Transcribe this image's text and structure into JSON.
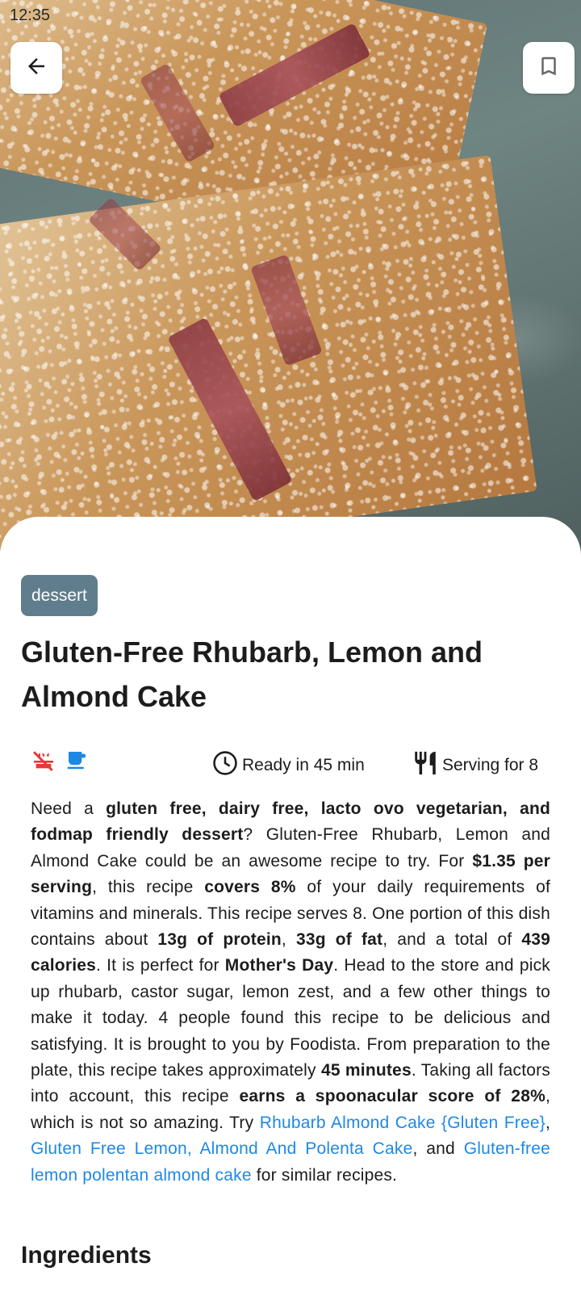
{
  "status_bar": {
    "time": "12:35"
  },
  "hero": {
    "image_alt": "Gluten-Free Rhubarb, Lemon and Almond Cake"
  },
  "colors": {
    "chip_bg": "#5f7d8c",
    "link": "#1e88e5",
    "icon_red": "#e53935",
    "icon_blue": "#1e88e5"
  },
  "recipe": {
    "tag": "dessert",
    "title": "Gluten-Free Rhubarb, Lemon and Almond Cake",
    "ready_in": "Ready in 45 min",
    "servings": "Serving for 8",
    "diet_icons": [
      "dairy-free-icon",
      "coffee-cup-icon"
    ],
    "summary": {
      "s1": "Need a ",
      "b1": "gluten free, dairy free, lacto ovo vegetarian, and fodmap friendly dessert",
      "s2": "? Gluten-Free Rhubarb, Lemon and Almond Cake could be an awesome recipe to try. For ",
      "b2": "$1.35 per serving",
      "s3": ", this recipe ",
      "b3": "covers 8%",
      "s4": " of your daily requirements of vitamins and minerals. This recipe serves 8. One portion of this dish contains about ",
      "b4": "13g of protein",
      "s5": ", ",
      "b5": "33g of fat",
      "s6": ", and a total of ",
      "b6": "439 calories",
      "s7": ". It is perfect for ",
      "b7": "Mother's Day",
      "s8": ". Head to the store and pick up rhubarb, castor sugar, lemon zest, and a few other things to make it today. 4 people found this recipe to be delicious and satisfying. It is brought to you by Foodista. From preparation to the plate, this recipe takes approximately ",
      "b8": "45 minutes",
      "s9": ". Taking all factors into account, this recipe ",
      "b9": "earns a spoonacular score of 28%",
      "s10": ", which is not so amazing. Try ",
      "l1": "Rhubarb Almond Cake {Gluten Free}",
      "s11": ", ",
      "l2": "Gluten Free Lemon, Almond And Polenta Cake",
      "s12": ", and ",
      "l3": "Gluten-free lemon polentan almond cake",
      "s13": " for similar recipes."
    }
  },
  "sections": {
    "ingredients": "Ingredients"
  }
}
